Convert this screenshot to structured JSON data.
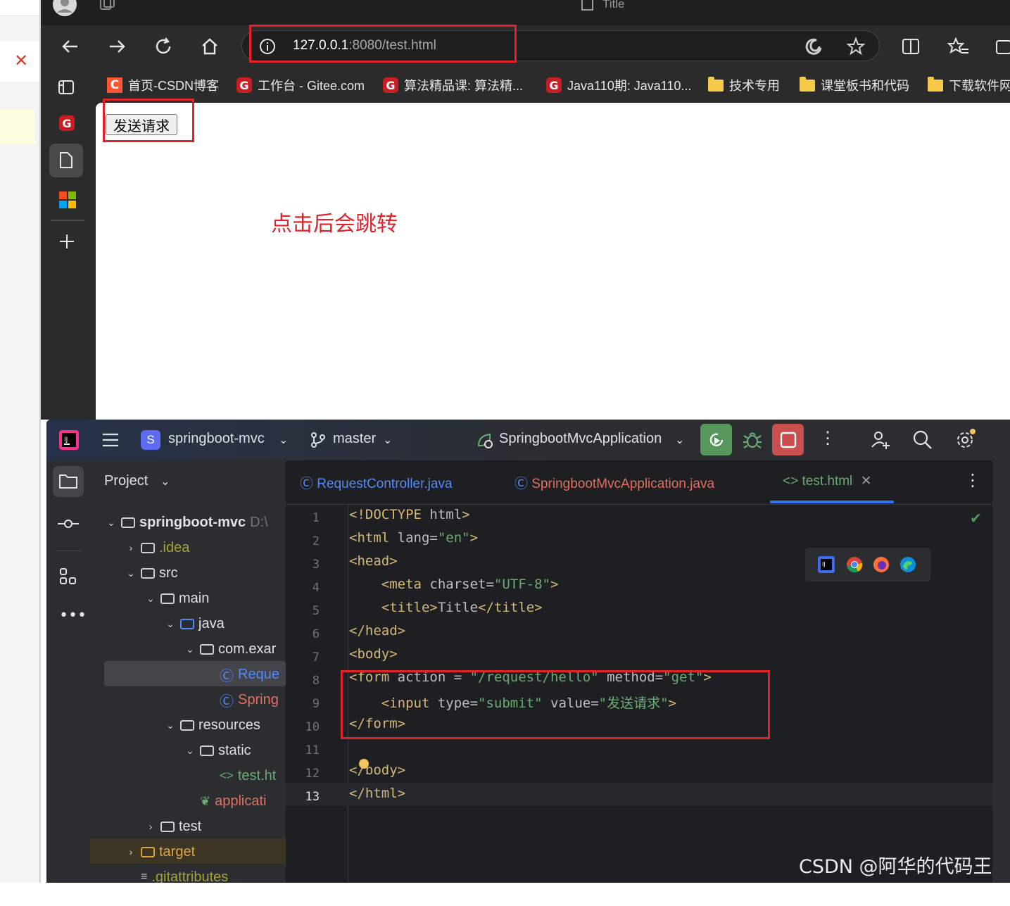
{
  "browser": {
    "tab_title": "Title",
    "address": {
      "host": "127.0.0.1",
      "rest": ":8080/test.html"
    },
    "bookmarks": [
      {
        "label": "首页-CSDN博客",
        "icon": "csdn-icon"
      },
      {
        "label": "工作台 - Gitee.com",
        "icon": "gitee-icon"
      },
      {
        "label": "算法精品课: 算法精...",
        "icon": "gitee-icon"
      },
      {
        "label": "Java110期: Java110...",
        "icon": "gitee-icon"
      },
      {
        "label": "技术专用",
        "icon": "folder-icon"
      },
      {
        "label": "课堂板书和代码",
        "icon": "folder-icon"
      },
      {
        "label": "下载软件网",
        "icon": "folder-icon"
      }
    ],
    "page": {
      "button_label": "发送请求"
    }
  },
  "annotation": {
    "text": "点击后会跳转"
  },
  "ide": {
    "project_name": "springboot-mvc",
    "project_badge": "S",
    "branch": "master",
    "run_config": "SpringbootMvcApplication",
    "project_panel_title": "Project",
    "tree": [
      {
        "label": "springboot-mvc",
        "suffix": "D:\\"
      },
      {
        "label": ".idea"
      },
      {
        "label": "src"
      },
      {
        "label": "main"
      },
      {
        "label": "java"
      },
      {
        "label": "com.exar"
      },
      {
        "label": "Reque"
      },
      {
        "label": "Spring"
      },
      {
        "label": "resources"
      },
      {
        "label": "static"
      },
      {
        "label": "test.ht"
      },
      {
        "label": "applicati"
      },
      {
        "label": "test"
      },
      {
        "label": "target"
      },
      {
        "label": ".gitattributes"
      }
    ],
    "tabs": [
      {
        "label": "RequestController.java"
      },
      {
        "label": "SpringbootMvcApplication.java"
      },
      {
        "label": "test.html"
      }
    ],
    "code_lines": [
      "<!DOCTYPE html>",
      "<html lang=\"en\">",
      "<head>",
      "    <meta charset=\"UTF-8\">",
      "    <title>Title</title>",
      "</head>",
      "<body>",
      "<form action = \"/request/hello\" method=\"get\">",
      "    <input type=\"submit\" value=\"发送请求\">",
      "</form>",
      "",
      "</body>",
      "</html>"
    ],
    "line_numbers": [
      "1",
      "2",
      "3",
      "4",
      "5",
      "6",
      "7",
      "8",
      "9",
      "10",
      "11",
      "12",
      "13"
    ]
  },
  "watermark": "CSDN @阿华的代码王国",
  "colors": {
    "highlight_red": "#e0222b",
    "ide_bg": "#1e1f22",
    "tag": "#d5b778",
    "string": "#6aab73"
  }
}
